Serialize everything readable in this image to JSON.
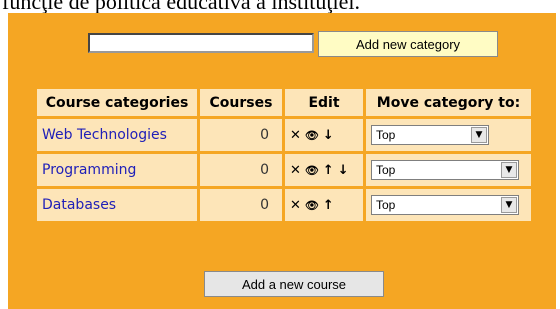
{
  "header": {
    "text": "funcţie de politica educativă a instituţiei."
  },
  "add_category": {
    "input_value": "",
    "button_label": "Add new category"
  },
  "table": {
    "headers": [
      "Course categories",
      "Courses",
      "Edit",
      "Move category to:"
    ],
    "rows": [
      {
        "name": "Web Technologies",
        "courses": "0",
        "move_to": "Top",
        "edit_icons": [
          "delete-icon",
          "hide-icon",
          "move-down-icon"
        ]
      },
      {
        "name": "Programming",
        "courses": "0",
        "move_to": "Top",
        "edit_icons": [
          "delete-icon",
          "hide-icon",
          "move-up-icon",
          "move-down-icon"
        ]
      },
      {
        "name": "Databases",
        "courses": "0",
        "move_to": "Top",
        "edit_icons": [
          "delete-icon",
          "hide-icon",
          "move-up-icon"
        ]
      }
    ]
  },
  "add_course": {
    "button_label": "Add a new course"
  },
  "colors": {
    "panel": "#f5a623",
    "cell": "#fde5b8",
    "link": "#2020b8",
    "add_button": "#fffcc4"
  }
}
